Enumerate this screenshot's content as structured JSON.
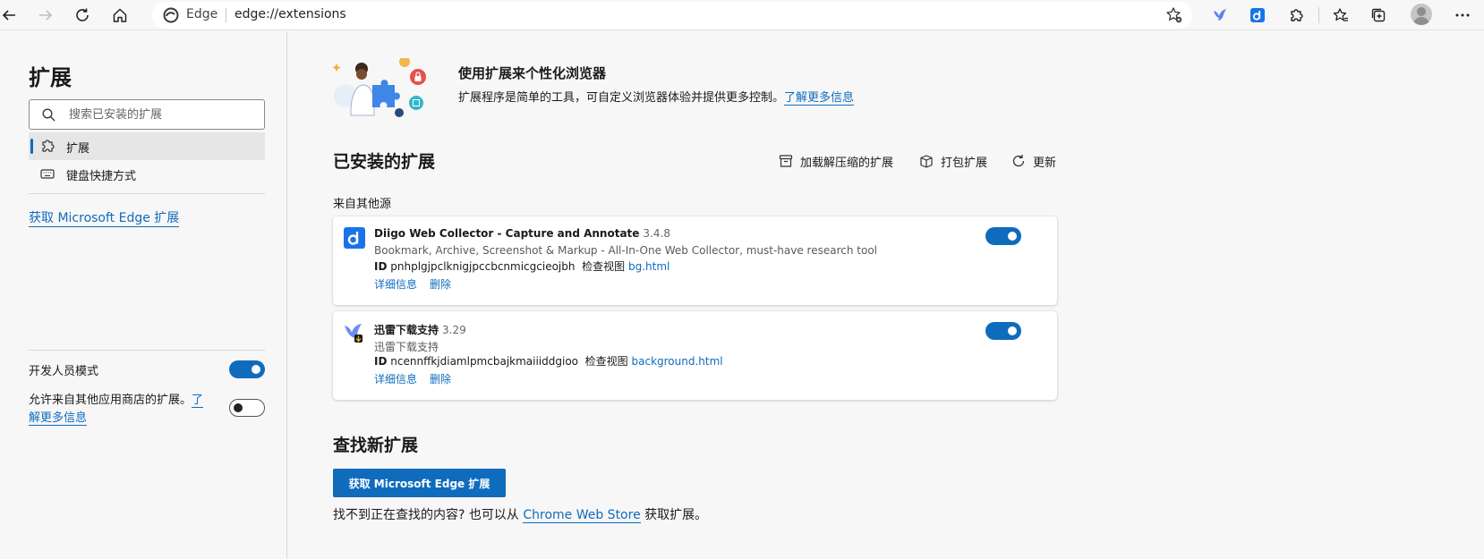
{
  "browser": {
    "address_brand": "Edge",
    "address_url": "edge://extensions",
    "accent": "#0f6cbd"
  },
  "sidebar": {
    "title": "扩展",
    "search_placeholder": "搜索已安装的扩展",
    "items": [
      {
        "label": "扩展",
        "icon": "puzzle-icon",
        "active": true
      },
      {
        "label": "键盘快捷方式",
        "icon": "keyboard-icon",
        "active": false
      }
    ],
    "get_extensions_link": "获取 Microsoft Edge 扩展",
    "developer_mode_label": "开发人员模式",
    "developer_mode": true,
    "allow_other_stores_text": "允许来自其他应用商店的扩展。",
    "learn_more_link": "了解更多信息",
    "allow_other_stores": false
  },
  "main": {
    "hero_title": "使用扩展来个性化浏览器",
    "hero_desc": "扩展程序是简单的工具，可自定义浏览器体验并提供更多控制。",
    "hero_link": "了解更多信息",
    "installed_title": "已安装的扩展",
    "actions": {
      "load_unpacked": "加载解压缩的扩展",
      "pack": "打包扩展",
      "update": "更新"
    },
    "source_label": "来自其他源",
    "extensions": [
      {
        "name": "Diigo Web Collector - Capture and Annotate",
        "version": "3.4.8",
        "description": "Bookmark, Archive, Screenshot & Markup - All-In-One Web Collector, must-have research tool",
        "id_label": "ID",
        "id": "pnhplgjpclknigjpccbcnmicgcieojbh",
        "inspect_label": "检查视图",
        "inspect_link": "bg.html",
        "details": "详细信息",
        "remove": "删除",
        "enabled": true
      },
      {
        "name": "迅雷下载支持",
        "version": "3.29",
        "description": "迅雷下载支持",
        "id_label": "ID",
        "id": "ncennffkjdiamlpmcbajkmaiiiddgioo",
        "inspect_label": "检查视图",
        "inspect_link": "background.html",
        "details": "详细信息",
        "remove": "删除",
        "enabled": true
      }
    ],
    "find_title": "查找新扩展",
    "get_button": "获取 Microsoft Edge 扩展",
    "footer_prefix": "找不到正在查找的内容? 也可以从",
    "footer_link": "Chrome Web Store",
    "footer_suffix": "获取扩展。"
  }
}
